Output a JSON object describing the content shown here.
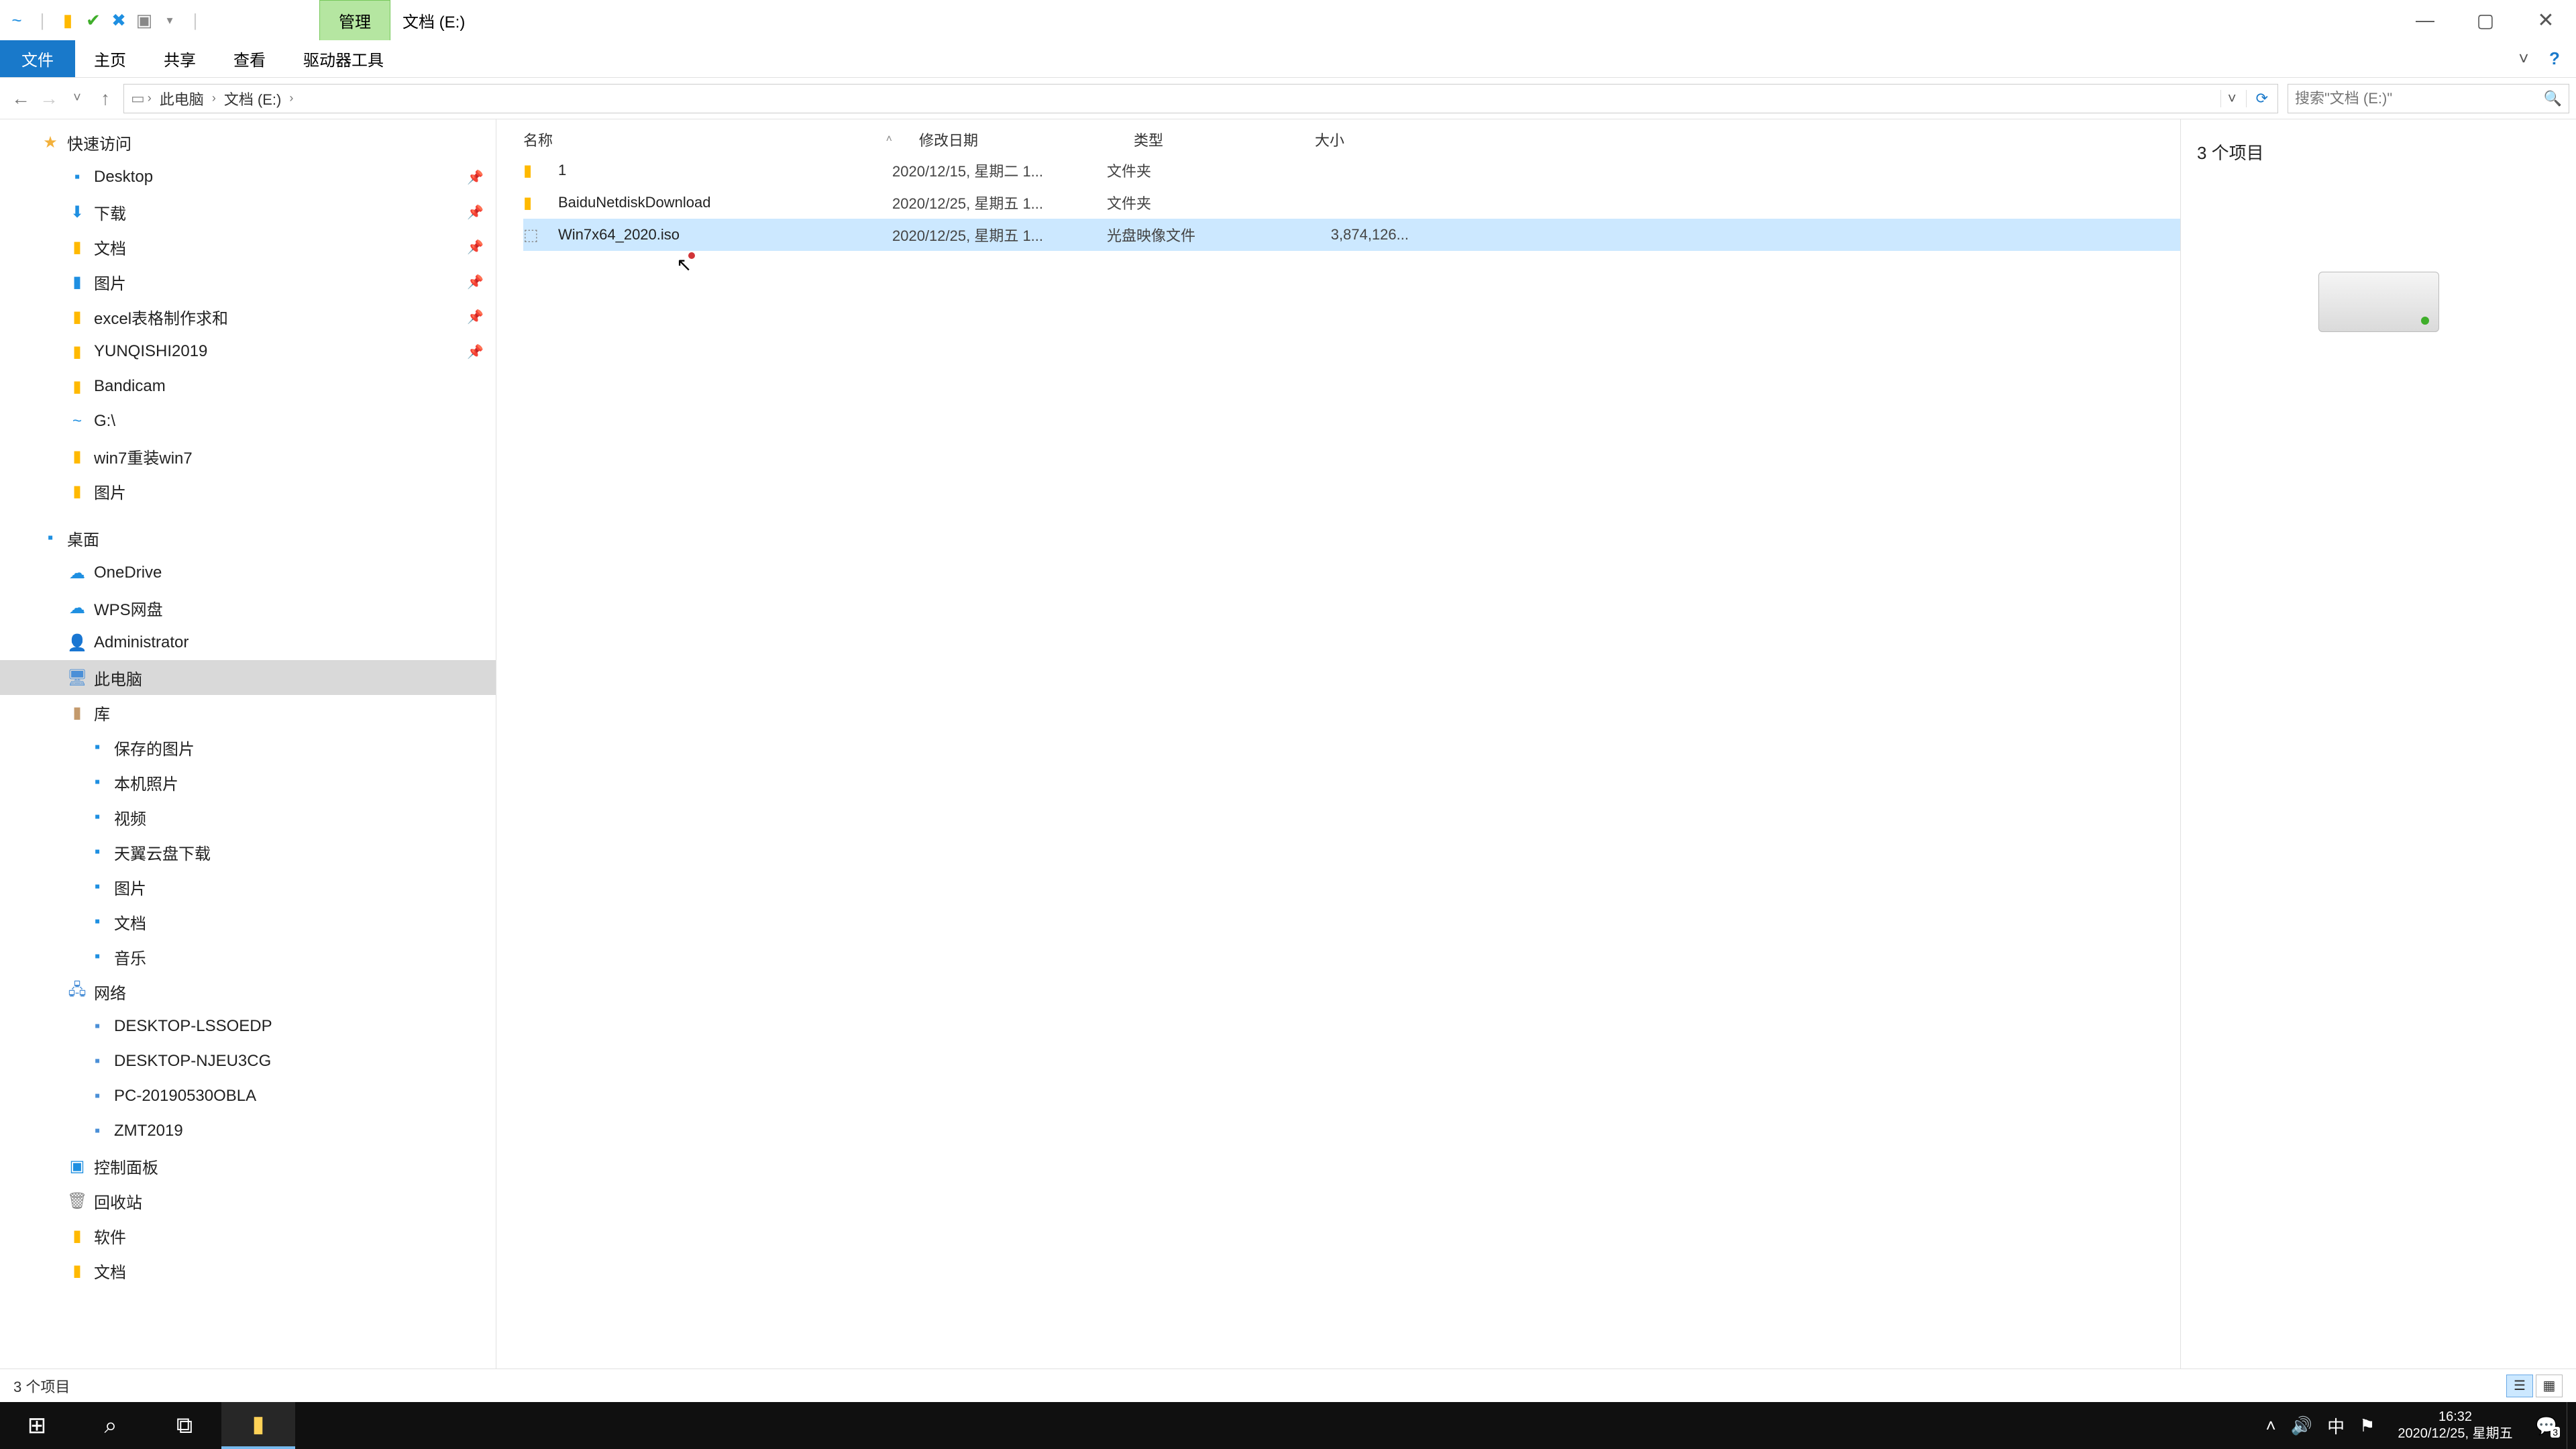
{
  "titlebar": {
    "mgmt_tab": "管理",
    "title": "文档 (E:)"
  },
  "menubar": {
    "file": "文件",
    "home": "主页",
    "share": "共享",
    "view": "查看",
    "drivetools": "驱动器工具"
  },
  "breadcrumb": {
    "pc": "此电脑",
    "drive": "文档 (E:)"
  },
  "search": {
    "placeholder": "搜索\"文档 (E:)\""
  },
  "sidebar": {
    "quick": "快速访问",
    "desktop": "Desktop",
    "downloads": "下载",
    "docs": "文档",
    "pics": "图片",
    "excel": "excel表格制作求和",
    "yunqishi": "YUNQISHI2019",
    "bandicam": "Bandicam",
    "gdrive": "G:\\",
    "win7": "win7重装win7",
    "pics2": "图片",
    "desk": "桌面",
    "onedrive": "OneDrive",
    "wps": "WPS网盘",
    "admin": "Administrator",
    "thispc": "此电脑",
    "lib": "库",
    "savedpics": "保存的图片",
    "localphotos": "本机照片",
    "video": "视频",
    "tianyi": "天翼云盘下载",
    "pics3": "图片",
    "docs2": "文档",
    "music": "音乐",
    "network": "网络",
    "pc1": "DESKTOP-LSSOEDP",
    "pc2": "DESKTOP-NJEU3CG",
    "pc3": "PC-20190530OBLA",
    "pc4": "ZMT2019",
    "ctrl": "控制面板",
    "recycle": "回收站",
    "soft": "软件",
    "docs3": "文档"
  },
  "columns": {
    "name": "名称",
    "date": "修改日期",
    "type": "类型",
    "size": "大小"
  },
  "rows": [
    {
      "name": "1",
      "date": "2020/12/15, 星期二 1...",
      "type": "文件夹",
      "size": "",
      "icon": "folder"
    },
    {
      "name": "BaiduNetdiskDownload",
      "date": "2020/12/25, 星期五 1...",
      "type": "文件夹",
      "size": "",
      "icon": "folder"
    },
    {
      "name": "Win7x64_2020.iso",
      "date": "2020/12/25, 星期五 1...",
      "type": "光盘映像文件",
      "size": "3,874,126...",
      "icon": "iso",
      "selected": true
    }
  ],
  "preview": {
    "count": "3 个项目"
  },
  "statusbar": {
    "count": "3 个项目"
  },
  "tray": {
    "ime": "中",
    "time": "16:32",
    "date": "2020/12/25, 星期五",
    "notif_badge": "3"
  }
}
